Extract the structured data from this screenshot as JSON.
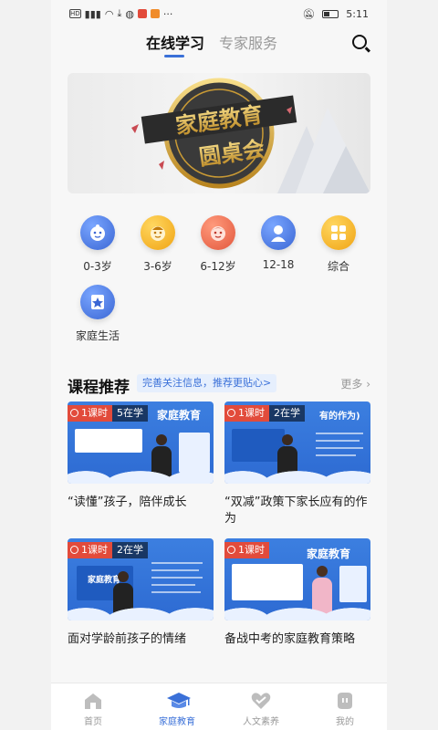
{
  "status_bar": {
    "time": "5:11",
    "battery": "◧"
  },
  "top_tabs": [
    {
      "label": "在线学习",
      "active": true
    },
    {
      "label": "专家服务",
      "active": false
    }
  ],
  "banner": {
    "main_text": "家庭教育",
    "sub_text": "圆桌会"
  },
  "categories": [
    {
      "label": "0-3岁",
      "icon": "baby-face-icon"
    },
    {
      "label": "3-6岁",
      "icon": "child-face-icon"
    },
    {
      "label": "6-12岁",
      "icon": "kid-face-icon"
    },
    {
      "label": "12-18",
      "icon": "teen-icon"
    },
    {
      "label": "综合",
      "icon": "grid-icon"
    },
    {
      "label": "家庭生活",
      "icon": "star-book-icon"
    }
  ],
  "section": {
    "title": "课程推荐",
    "tag": "完善关注信息，推荐更贴心>",
    "more": "更多"
  },
  "courses": [
    {
      "lessons": "1课时",
      "learners": "5在学",
      "thumb_text": "家庭教育",
      "title": "“读懂”孩子，陪伴成长"
    },
    {
      "lessons": "1课时",
      "learners": "2在学",
      "thumb_text": "有的作为)",
      "title": "“双减”政策下家长应有的作为"
    },
    {
      "lessons": "1课时",
      "learners": "2在学",
      "thumb_text": "家庭教育",
      "title": "面对学龄前孩子的情绪"
    },
    {
      "lessons": "1课时",
      "learners": "",
      "thumb_text": "家庭教育",
      "title": "备战中考的家庭教育策略"
    }
  ],
  "bottom_nav": [
    {
      "label": "首页",
      "icon": "home-icon",
      "active": false
    },
    {
      "label": "家庭教育",
      "icon": "graduation-cap-icon",
      "active": true
    },
    {
      "label": "人文素养",
      "icon": "heart-icon",
      "active": false
    },
    {
      "label": "我的",
      "icon": "profile-icon",
      "active": false
    }
  ],
  "colors": {
    "accent": "#3a70d8",
    "badge_red": "#e24b3b",
    "thumb_blue": "#2d6ad2"
  }
}
